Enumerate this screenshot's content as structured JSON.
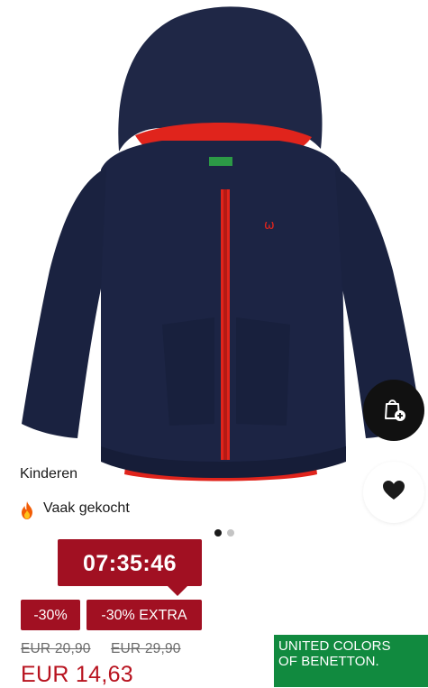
{
  "product": {
    "category_tag": "Kinderen",
    "popular_tag": "Vaak gekocht",
    "image_alt": "jacket"
  },
  "carousel": {
    "total": 2,
    "active_index": 0
  },
  "promo": {
    "countdown": "07:35:46",
    "discount_badge": "-30%",
    "extra_badge": "-30% EXTRA",
    "color": "#a11022"
  },
  "pricing": {
    "original_price_1": "EUR 20,90",
    "original_price_2": "EUR 29,90",
    "current_price": "EUR 14,63",
    "price_color": "#b8131f"
  },
  "brand": {
    "logo_line_1": "UNITED COLORS",
    "logo_line_2": "OF BENETTON.",
    "logo_color": "#118a3f"
  },
  "icons": {
    "add_to_bag": "shopping-bag-plus-icon",
    "wishlist": "heart-icon",
    "popular": "fire-icon"
  }
}
